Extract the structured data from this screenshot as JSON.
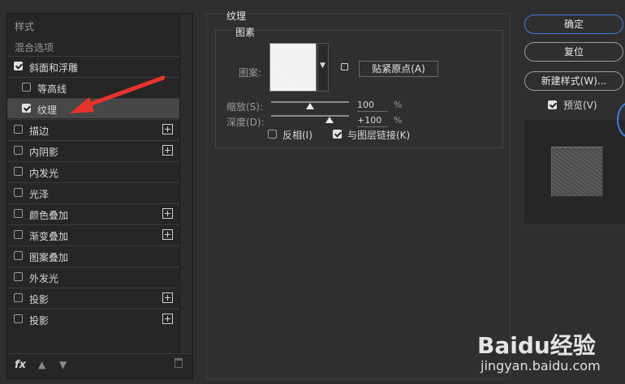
{
  "left": {
    "header_style": "样式",
    "header_blend": "混合选项",
    "items": [
      {
        "label": "斜面和浮雕",
        "checked": true,
        "plus": false,
        "indent": false,
        "selected": false
      },
      {
        "label": "等高线",
        "checked": false,
        "plus": false,
        "indent": true,
        "selected": false
      },
      {
        "label": "纹理",
        "checked": true,
        "plus": false,
        "indent": true,
        "selected": true
      },
      {
        "label": "描边",
        "checked": false,
        "plus": true,
        "indent": false,
        "selected": false
      },
      {
        "label": "内阴影",
        "checked": false,
        "plus": true,
        "indent": false,
        "selected": false
      },
      {
        "label": "内发光",
        "checked": false,
        "plus": false,
        "indent": false,
        "selected": false
      },
      {
        "label": "光泽",
        "checked": false,
        "plus": false,
        "indent": false,
        "selected": false
      },
      {
        "label": "颜色叠加",
        "checked": false,
        "plus": true,
        "indent": false,
        "selected": false
      },
      {
        "label": "渐变叠加",
        "checked": false,
        "plus": true,
        "indent": false,
        "selected": false
      },
      {
        "label": "图案叠加",
        "checked": false,
        "plus": false,
        "indent": false,
        "selected": false
      },
      {
        "label": "外发光",
        "checked": false,
        "plus": false,
        "indent": false,
        "selected": false
      },
      {
        "label": "投影",
        "checked": false,
        "plus": true,
        "indent": false,
        "selected": false
      },
      {
        "label": "投影",
        "checked": false,
        "plus": true,
        "indent": false,
        "selected": false
      }
    ],
    "fx_label": "fx"
  },
  "texture": {
    "title": "纹理",
    "group_title": "图素",
    "pattern_label": "图案:",
    "snap_button": "贴紧原点(A)",
    "scale_label": "缩放(S):",
    "scale_value": "100",
    "scale_fraction": 0.5,
    "depth_label": "深度(D):",
    "depth_value": "+100",
    "depth_fraction": 0.75,
    "percent": "%",
    "invert_label": "反相(I)",
    "invert_checked": false,
    "link_label": "与图层链接(K)",
    "link_checked": true
  },
  "right": {
    "ok": "确定",
    "reset": "复位",
    "new_style": "新建样式(W)...",
    "preview_label": "预览(V)",
    "preview_checked": true
  },
  "watermark": {
    "logo": "Baidu经验",
    "sub": "jingyan.baidu.com"
  },
  "colors": {
    "arrow": "#e8332a",
    "accent": "#3f7fe0"
  }
}
